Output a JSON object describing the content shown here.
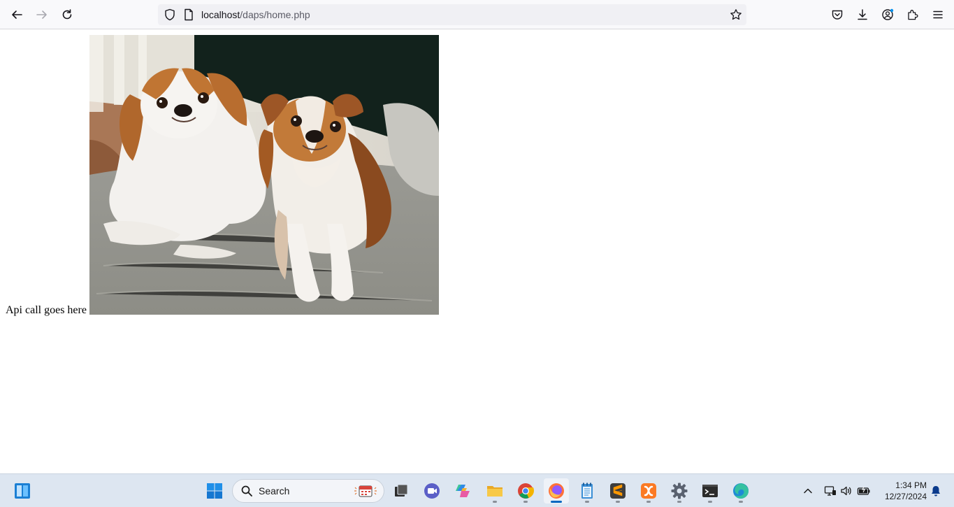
{
  "browser": {
    "url_host": "localhost",
    "url_path": "/daps/home.php"
  },
  "page": {
    "api_text": "Api call goes here",
    "image_alt": "Two dogs lying on a couch"
  },
  "taskbar": {
    "search_label": "Search",
    "apps": [
      "file-explorer",
      "chrome",
      "firefox",
      "notepad",
      "sublime-text",
      "xampp",
      "settings",
      "terminal",
      "edge"
    ],
    "active_app": "firefox"
  },
  "clock": {
    "time": "1:34 PM",
    "date": "12/27/2024"
  },
  "colors": {
    "accent": "#0067c0",
    "toolbar_bg": "#f9f9fb",
    "taskbar_bg": "#dde6f1"
  }
}
